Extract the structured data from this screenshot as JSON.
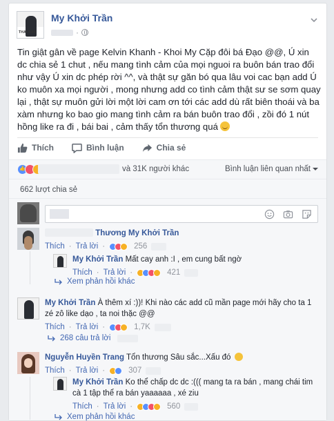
{
  "post": {
    "page_name": "My Khởi Trần",
    "page_avatar_text": "THAI BAN",
    "text": "Tin giật gân về page Kelvin Khanh - Khoi My Cặp đôi bá Đạo @@, Ú xin dc chia sẻ 1 chut , nếu mang tình cảm của mọi nguoi ra buôn bán trao đổi như vậy Ú xin dc phép rời ^^, và thật sự găn bó qua lâu voi cac bạn add Ú ko muôn xa mọi người , mong nhưng add co tình cảm thật sư se sơm quay lại , thật sự muôn gửi lời một lời cam ơn tới các add dù rất biên thoái và ba xàm nhưng ko bao gio mang tình cảm ra bán buôn trao đổi , zồi đó 1 nút hồng like ra đi , bái bai , cảm thấy tổn thương quá"
  },
  "actions": {
    "like": "Thích",
    "comment": "Bình luận",
    "share": "Chia sẻ"
  },
  "stats": {
    "reactions_text": "và 31K người khác",
    "related_comments": "Bình luận liên quan nhất",
    "shares": "662 lượt chia sẻ"
  },
  "comments": [
    {
      "author_suffix": "Thương",
      "mention": "My Khởi Trần",
      "text": "",
      "like": "Thích",
      "reply": "Trả lời",
      "count": "256"
    },
    {
      "author": "My Khởi Trần",
      "text": "Mất cay anh :I , em cung bất ngờ",
      "like": "Thích",
      "reply": "Trả lời",
      "count": "421"
    },
    {
      "more_replies": "Xem phản hồi khác"
    },
    {
      "author": "My Khởi Trần",
      "text": "À thêm xí :))! Khi nào các add cũ mần page mới hãy cho ta 1 zé zô like dạo , ta noi thặc @@",
      "like": "Thích",
      "reply": "Trả lời",
      "count": "1,7K"
    },
    {
      "more_replies": "268 câu trả lời"
    },
    {
      "author": "Nguyễn Huyền Trang",
      "text": "Tổn thương Sâu sắc...Xấu đó",
      "like": "Thích",
      "reply": "Trả lời",
      "count": "307"
    },
    {
      "author": "My Khởi Trần",
      "text": "Ko thể chấp dc dc :((( mang ta ra bán , mang chái tim cà 1 tập thể ra bán yaaaaaa , xé ziu",
      "like": "Thích",
      "reply": "Trả lời",
      "count": "560"
    },
    {
      "more_replies": "Xem phản hồi khác"
    }
  ],
  "colors": {
    "link": "#365899",
    "like_blue": "#5890ff",
    "love_red": "#f25268",
    "haha_yellow": "#f7b125",
    "background": "#e9ebee"
  }
}
